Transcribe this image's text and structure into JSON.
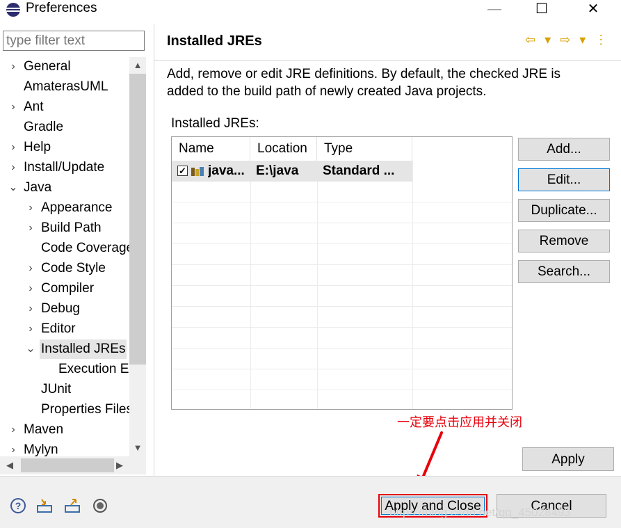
{
  "window": {
    "title": "Preferences",
    "minimize": "—",
    "maximize": "☐",
    "close": "✕"
  },
  "filter": {
    "placeholder": "type filter text"
  },
  "tree": [
    {
      "label": "General",
      "chevron": "›"
    },
    {
      "label": "AmaterasUML",
      "chevron": ""
    },
    {
      "label": "Ant",
      "chevron": "›"
    },
    {
      "label": "Gradle",
      "chevron": ""
    },
    {
      "label": "Help",
      "chevron": "›"
    },
    {
      "label": "Install/Update",
      "chevron": "›"
    },
    {
      "label": "Java",
      "chevron": "⌄"
    },
    {
      "label": "Appearance",
      "chevron": "›"
    },
    {
      "label": "Build Path",
      "chevron": "›"
    },
    {
      "label": "Code Coverage",
      "chevron": ""
    },
    {
      "label": "Code Style",
      "chevron": "›"
    },
    {
      "label": "Compiler",
      "chevron": "›"
    },
    {
      "label": "Debug",
      "chevron": "›"
    },
    {
      "label": "Editor",
      "chevron": "›"
    },
    {
      "label": "Installed JREs",
      "chevron": "⌄"
    },
    {
      "label": "Execution Environments",
      "chevron": ""
    },
    {
      "label": "JUnit",
      "chevron": ""
    },
    {
      "label": "Properties Files Editor",
      "chevron": ""
    },
    {
      "label": "Maven",
      "chevron": "›"
    },
    {
      "label": "Mylyn",
      "chevron": "›"
    }
  ],
  "page": {
    "title": "Installed JREs",
    "nav": "⇦ ▾ ⇨ ▾ ⋮",
    "desc_line1": "Add, remove or edit JRE definitions. By default, the checked JRE is",
    "desc_line2": "added to the build path of newly created Java projects.",
    "table_label": "Installed JREs:",
    "columns": [
      "Name",
      "Location",
      "Type"
    ],
    "rows": [
      {
        "name": "java...",
        "location": "E:\\java",
        "type": "Standard ..."
      }
    ]
  },
  "buttons": {
    "add": "Add...",
    "edit": "Edit...",
    "duplicate": "Duplicate...",
    "remove": "Remove",
    "search": "Search...",
    "apply": "Apply",
    "apply_close": "Apply and Close",
    "cancel": "Cancel"
  },
  "annotation": "一定要点击应用并关闭",
  "watermark": "https://blog.csdn.net/qq_45028493",
  "colors": {
    "accent": "#0078d7",
    "annotation": "#e8000b",
    "selection": "#e5e5e5"
  }
}
